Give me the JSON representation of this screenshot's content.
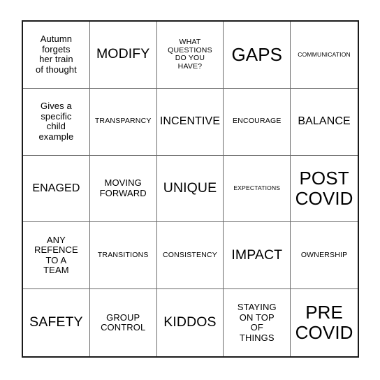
{
  "card": {
    "type": "bingo-card",
    "rows": 5,
    "columns": 5,
    "background_color": "#ffffff",
    "text_color": "#000000",
    "outer_border_color": "#1a1a1a",
    "grid_line_color": "#6b6b6b",
    "cells": [
      {
        "text": "Autumn\nforgets\nher train\nof thought",
        "size": "md"
      },
      {
        "text": "MODIFY",
        "size": "xl"
      },
      {
        "text": "WHAT\nQUESTIONS\nDO YOU\nHAVE?",
        "size": "sm"
      },
      {
        "text": "GAPS",
        "size": "xxl"
      },
      {
        "text": "COMMUNICATION",
        "size": "xs"
      },
      {
        "text": "Gives a\nspecific\nchild\nexample",
        "size": "md"
      },
      {
        "text": "TRANSPARNCY",
        "size": "sm"
      },
      {
        "text": "INCENTIVE",
        "size": "lg"
      },
      {
        "text": "ENCOURAGE",
        "size": "sm"
      },
      {
        "text": "BALANCE",
        "size": "lg"
      },
      {
        "text": "ENAGED",
        "size": "lg"
      },
      {
        "text": "MOVING\nFORWARD",
        "size": "md"
      },
      {
        "text": "UNIQUE",
        "size": "xl"
      },
      {
        "text": "EXPECTATIONS",
        "size": "xs"
      },
      {
        "text": "POST\nCOVID",
        "size": "xxl"
      },
      {
        "text": "ANY\nREFENCE\nTO A\nTEAM",
        "size": "md"
      },
      {
        "text": "TRANSITIONS",
        "size": "sm"
      },
      {
        "text": "CONSISTENCY",
        "size": "sm"
      },
      {
        "text": "IMPACT",
        "size": "xl"
      },
      {
        "text": "OWNERSHIP",
        "size": "sm"
      },
      {
        "text": "SAFETY",
        "size": "xl"
      },
      {
        "text": "GROUP\nCONTROL",
        "size": "md"
      },
      {
        "text": "KIDDOS",
        "size": "xl"
      },
      {
        "text": "STAYING\nON TOP\nOF\nTHINGS",
        "size": "md"
      },
      {
        "text": "PRE\nCOVID",
        "size": "xxl"
      }
    ]
  }
}
